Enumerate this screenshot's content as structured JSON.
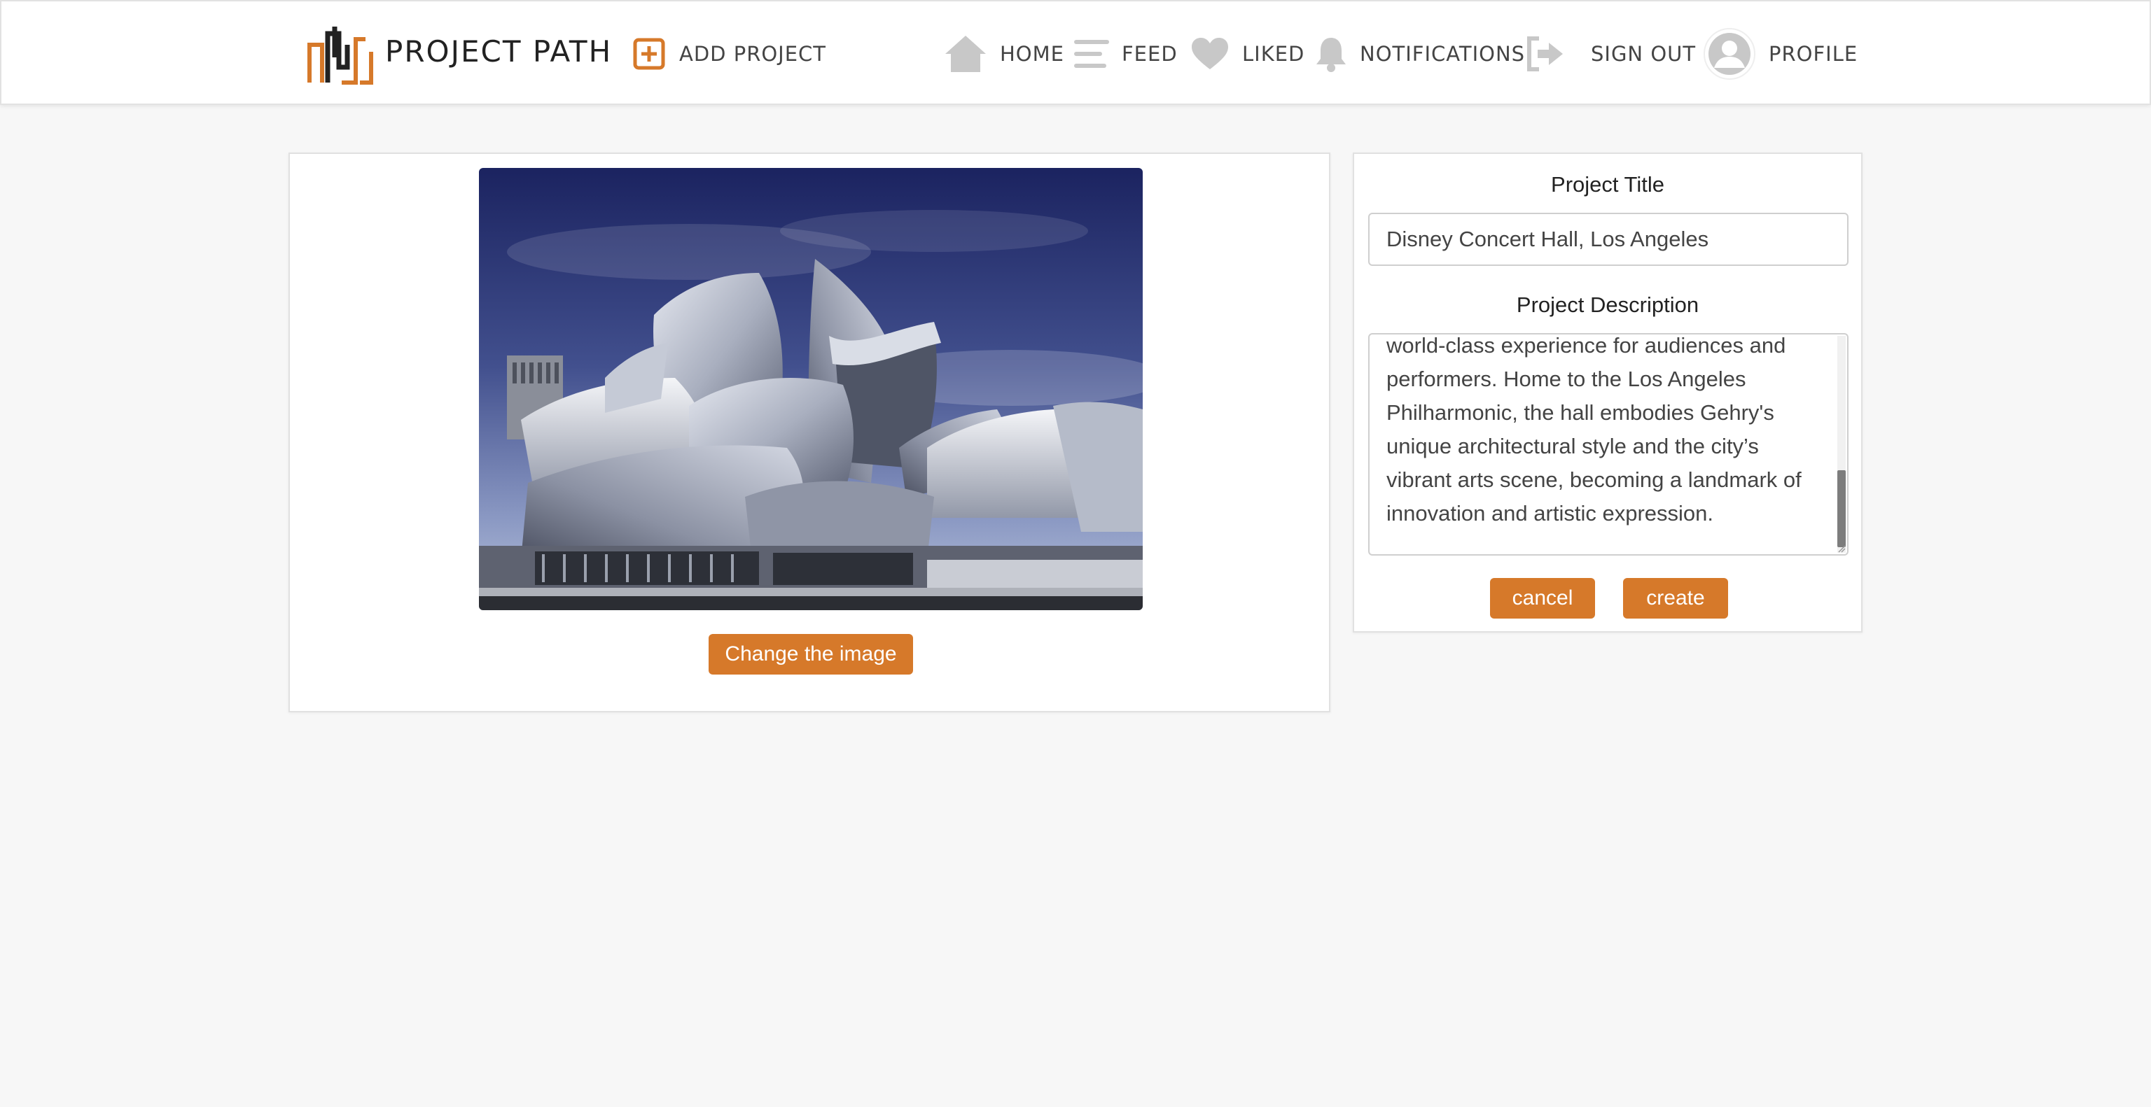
{
  "header": {
    "brand": "PROJECT PATH",
    "nav": {
      "add_project": "ADD PROJECT",
      "home": "HOME",
      "feed": "FEED",
      "liked": "LIKED",
      "notifications": "NOTIFICATIONS",
      "sign_out": "SIGN OUT",
      "profile": "PROFILE"
    },
    "icons": [
      "logo-icon",
      "add-icon",
      "home-icon",
      "feed-icon",
      "heart-icon",
      "bell-icon",
      "sign-out-icon",
      "avatar-icon"
    ]
  },
  "image_panel": {
    "change_image_label": "Change the image"
  },
  "form": {
    "title_label": "Project Title",
    "title_value": "Disney Concert Hall, Los Angeles",
    "description_label": "Project Description",
    "description_value": "acoustician Yasuhisa Toyota, providing a world-class experience for audiences and performers. Home to the Los Angeles Philharmonic, the hall embodies Gehry's unique architectural style and the city’s vibrant arts scene, becoming a landmark of innovation and artistic expression.",
    "cancel_label": "cancel",
    "create_label": "create"
  },
  "colors": {
    "accent": "#d6792a",
    "background": "#f7f7f7",
    "nav_icon": "#c8c8c8"
  }
}
